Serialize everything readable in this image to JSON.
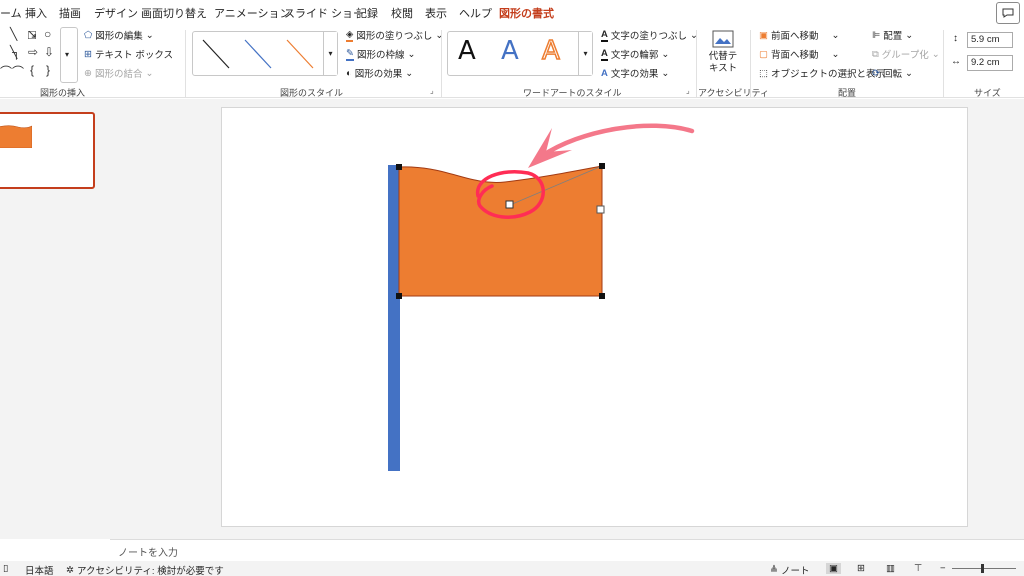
{
  "tabs": {
    "items": [
      "ーム",
      "挿入",
      "描画",
      "デザイン",
      "画面切り替え",
      "アニメーション",
      "スライド ショー",
      "記録",
      "校閲",
      "表示",
      "ヘルプ",
      "図形の書式"
    ],
    "active": "図形の書式"
  },
  "ribbon": {
    "insert_shapes": {
      "label": "図形の挿入",
      "edit_shape": "図形の編集",
      "text_box": "テキスト ボックス",
      "merge_shapes": "図形の結合"
    },
    "shape_styles": {
      "label": "図形のスタイル",
      "fill": "図形の塗りつぶし",
      "outline": "図形の枠線",
      "effects": "図形の効果"
    },
    "wordart": {
      "label": "ワードアートのスタイル",
      "letters": [
        "A",
        "A",
        "A"
      ],
      "text_fill": "文字の塗りつぶし",
      "text_outline": "文字の輪郭",
      "text_effects": "文字の効果"
    },
    "accessibility": {
      "label": "アクセシビリティ",
      "alt_text_line1": "代替テ",
      "alt_text_line2": "キスト"
    },
    "arrange": {
      "label": "配置",
      "bring_forward": "前面へ移動",
      "send_backward": "背面へ移動",
      "selection_pane": "オブジェクトの選択と表示",
      "align": "配置",
      "group": "グループ化",
      "rotate": "回転"
    },
    "size": {
      "label": "サイズ",
      "height": "5.9 cm",
      "width": "9.2 cm"
    }
  },
  "notes": {
    "placeholder": "ノートを入力"
  },
  "status": {
    "language": "日本語",
    "accessibility": "アクセシビリティ: 検討が必要です",
    "notes_button": "ノート"
  },
  "colors": {
    "accent": "#c43e1c",
    "flag_fill": "#ed7d31",
    "pole_fill": "#4472c4",
    "annotation": "#ff2d55"
  }
}
